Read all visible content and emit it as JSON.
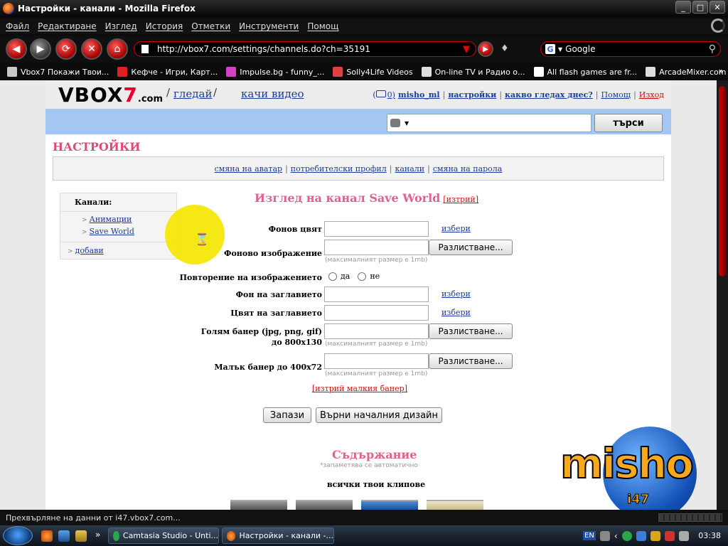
{
  "window": {
    "title": "Настройки - канали - Mozilla Firefox"
  },
  "menu": [
    "Файл",
    "Редактиране",
    "Изглед",
    "История",
    "Отметки",
    "Инструменти",
    "Помощ"
  ],
  "nav": {
    "url": "http://vbox7.com/settings/channels.do?ch=35191",
    "search_engine": "Google"
  },
  "bookmarks": [
    {
      "label": "Vbox7 Покажи Твои...",
      "color": "#c9c9c9"
    },
    {
      "label": "Кефче - Игри, Карт...",
      "color": "#e02020"
    },
    {
      "label": "Impulse.bg - funny_...",
      "color": "#d640c8"
    },
    {
      "label": "Solly4Life Videos",
      "color": "#e04040"
    },
    {
      "label": "On-line TV и Радио о...",
      "color": "#dddddd"
    },
    {
      "label": "All flash games are fr...",
      "color": "#ffffff"
    },
    {
      "label": "ArcadeMixer.com - Fl...",
      "color": "#dddddd"
    }
  ],
  "site": {
    "logo": {
      "main": "VBOX",
      "seven": "7",
      "dotcom": ".com"
    },
    "watch": "гледай",
    "upload": "качи видео",
    "user": {
      "messages": "0)",
      "username": "misho_ml",
      "settings": "настройки",
      "what_watching": "какво гледах днес?",
      "help": "Помощ",
      "logout": "Изход"
    },
    "search_button": "търси"
  },
  "settings": {
    "title": "НАСТРОЙКИ",
    "tabs": [
      "смяна на аватар",
      "потребителски профил",
      "канали",
      "смяна на парола"
    ]
  },
  "sidebar": {
    "head": "Канали:",
    "channels": [
      "Анимации",
      "Save World"
    ],
    "add": "добави"
  },
  "form": {
    "title": "Изглед на канал Save World",
    "delete": "[изтрий]",
    "bg_color": "Фонов цвят",
    "bg_image": "Фоново изображение",
    "repeat": "Повторение на изображението",
    "yes": "да",
    "no": "не",
    "header_bg": "Фон на заглавието",
    "header_color": "Цвят на заглавието",
    "big_banner_1": "Голям банер (jpg, png, gif)",
    "big_banner_2": "до 800x130",
    "small_banner": "Малък банер до 400x72",
    "choose": "избери",
    "browse": "Разлистване...",
    "max_size": "(максималният размер е 1mb)",
    "delete_small": "[изтрий малкия банер]",
    "save": "Запази",
    "reset": "Върни началния дизайн"
  },
  "contents": {
    "title": "Съдържание",
    "hint": "*запаметява се автоматично",
    "all_clips": "всички твои клипове"
  },
  "watermark": {
    "text": "misho",
    "sub": "i47"
  },
  "status": "Прехвърляне на данни от i47.vbox7.com...",
  "taskbar": {
    "tasks": [
      "Camtasia Studio - Unti...",
      "Настройки - канали -..."
    ],
    "lang": "EN",
    "clock": "03:38"
  }
}
